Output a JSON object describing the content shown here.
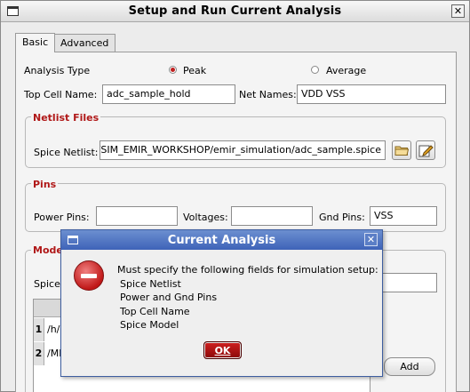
{
  "window": {
    "title": "Setup and Run Current Analysis",
    "close": "✕"
  },
  "tabs": [
    {
      "label": "Basic",
      "active": true
    },
    {
      "label": "Advanced",
      "active": false
    }
  ],
  "analysis": {
    "label": "Analysis Type",
    "options": [
      {
        "label": "Peak",
        "selected": true
      },
      {
        "label": "Average",
        "selected": false
      }
    ]
  },
  "top_cell": {
    "label": "Top Cell Name:",
    "value": "adc_sample_hold"
  },
  "net_names": {
    "label": "Net Names:",
    "value": "VDD VSS"
  },
  "netlist": {
    "title": "Netlist Files",
    "spice_label": "Spice Netlist:",
    "spice_value": "/SIM_EMIR_WORKSHOP/emir_simulation/adc_sample.spice"
  },
  "pins": {
    "title": "Pins",
    "power_label": "Power Pins:",
    "power_value": "",
    "voltages_label": "Voltages:",
    "voltages_value": "",
    "gnd_label": "Gnd Pins:",
    "gnd_value": "VSS"
  },
  "model": {
    "title": "Model",
    "spice_label": "Spice",
    "rows": [
      {
        "num": "1",
        "value": "/h/l"
      },
      {
        "num": "2",
        "value": "/MM"
      }
    ],
    "add_label": "Add"
  },
  "dialog": {
    "title": "Current Analysis",
    "close": "✕",
    "message": "Must specify the following fields for simulation setup:",
    "fields": [
      "Spice Netlist",
      "Power and Gnd Pins",
      "Top Cell Name",
      "Spice Model"
    ],
    "ok_label": "OK"
  },
  "colors": {
    "section_title": "#b01818",
    "dialog_bar": "#3e63b8",
    "ok_button": "#b01010"
  }
}
